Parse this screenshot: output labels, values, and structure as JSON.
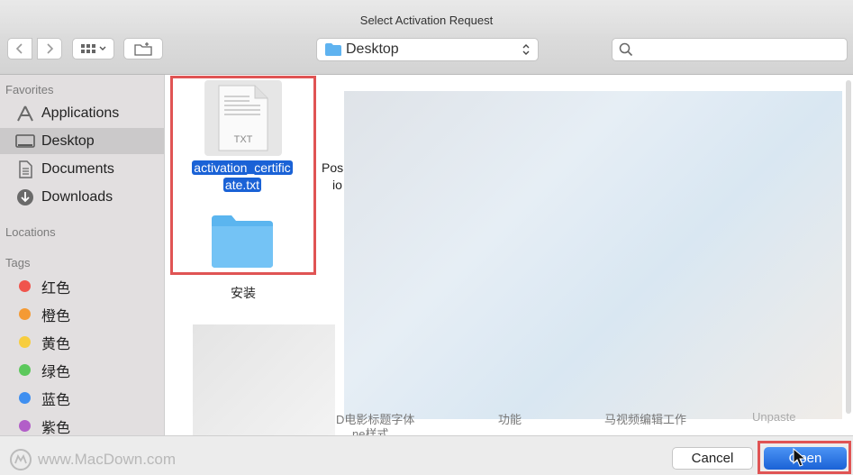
{
  "window": {
    "title": "Select Activation Request"
  },
  "toolbar": {
    "back_icon": "chevron-left-icon",
    "forward_icon": "chevron-right-icon",
    "view_icon": "grid-view-icon",
    "new_folder_icon": "new-folder-icon",
    "location": "Desktop",
    "search_placeholder": ""
  },
  "sidebar": {
    "favorites_header": "Favorites",
    "favorites": [
      {
        "label": "Applications",
        "icon": "applications-icon"
      },
      {
        "label": "Desktop",
        "icon": "desktop-icon",
        "selected": true
      },
      {
        "label": "Documents",
        "icon": "documents-icon"
      },
      {
        "label": "Downloads",
        "icon": "downloads-icon"
      }
    ],
    "locations_header": "Locations",
    "tags_header": "Tags",
    "tags": [
      {
        "label": "红色",
        "color": "#f0544c"
      },
      {
        "label": "橙色",
        "color": "#f49a34"
      },
      {
        "label": "黄色",
        "color": "#f7cd3f"
      },
      {
        "label": "绿色",
        "color": "#5cc85c"
      },
      {
        "label": "蓝色",
        "color": "#3f8ff0"
      },
      {
        "label": "紫色",
        "color": "#b25ec8"
      }
    ]
  },
  "files": {
    "selected_file": {
      "ext": "TXT",
      "name_line1": "activation_certific",
      "name_line2": "ate.txt"
    },
    "folder_name": "安装",
    "partial_label_1a": "Pos",
    "partial_label_1b": "io",
    "bottom_partial_1a": "D电影标题字体",
    "bottom_partial_1b": "ne样式",
    "bottom_partial_2": "功能",
    "bottom_partial_3": "马视频编辑工作",
    "bottom_partial_4": "Unpaste"
  },
  "watermark": "www.MacDown.com",
  "buttons": {
    "cancel": "Cancel",
    "open": "Open"
  },
  "colors": {
    "accent": "#1a62d6",
    "highlight_box": "#e05454"
  }
}
